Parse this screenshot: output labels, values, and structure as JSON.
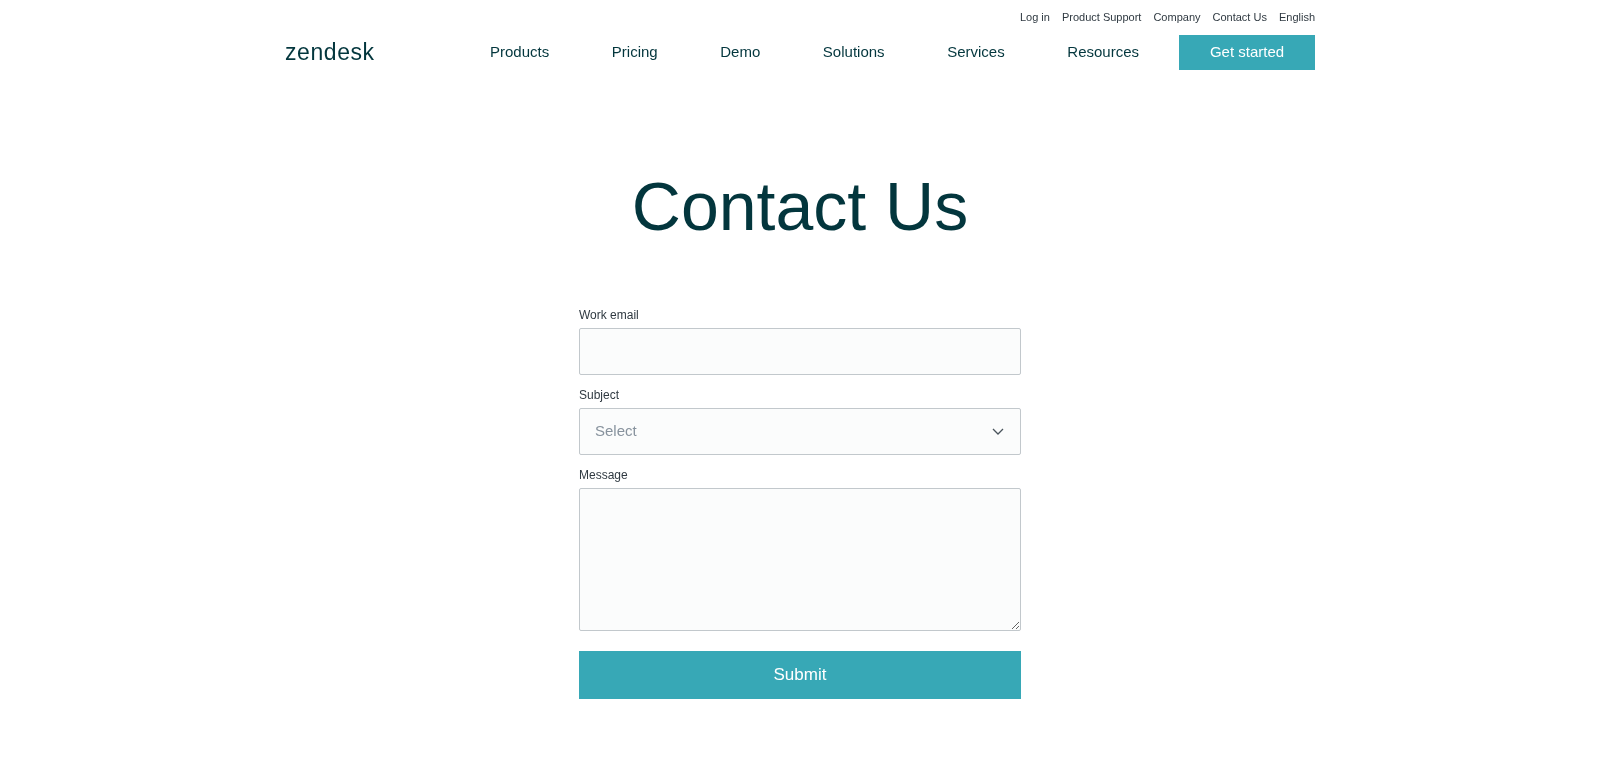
{
  "utility_links": [
    "Log in",
    "Product Support",
    "Company",
    "Contact Us",
    "English"
  ],
  "logo": "zendesk",
  "nav": [
    "Products",
    "Pricing",
    "Demo",
    "Solutions",
    "Services",
    "Resources"
  ],
  "cta_button": "Get started",
  "heading": "Contact Us",
  "form": {
    "fields": [
      {
        "kind": "input",
        "label": "Work email"
      },
      {
        "kind": "select",
        "label": "Subject",
        "placeholder": "Select"
      },
      {
        "kind": "textarea",
        "label": "Message"
      }
    ],
    "submit": "Submit"
  }
}
